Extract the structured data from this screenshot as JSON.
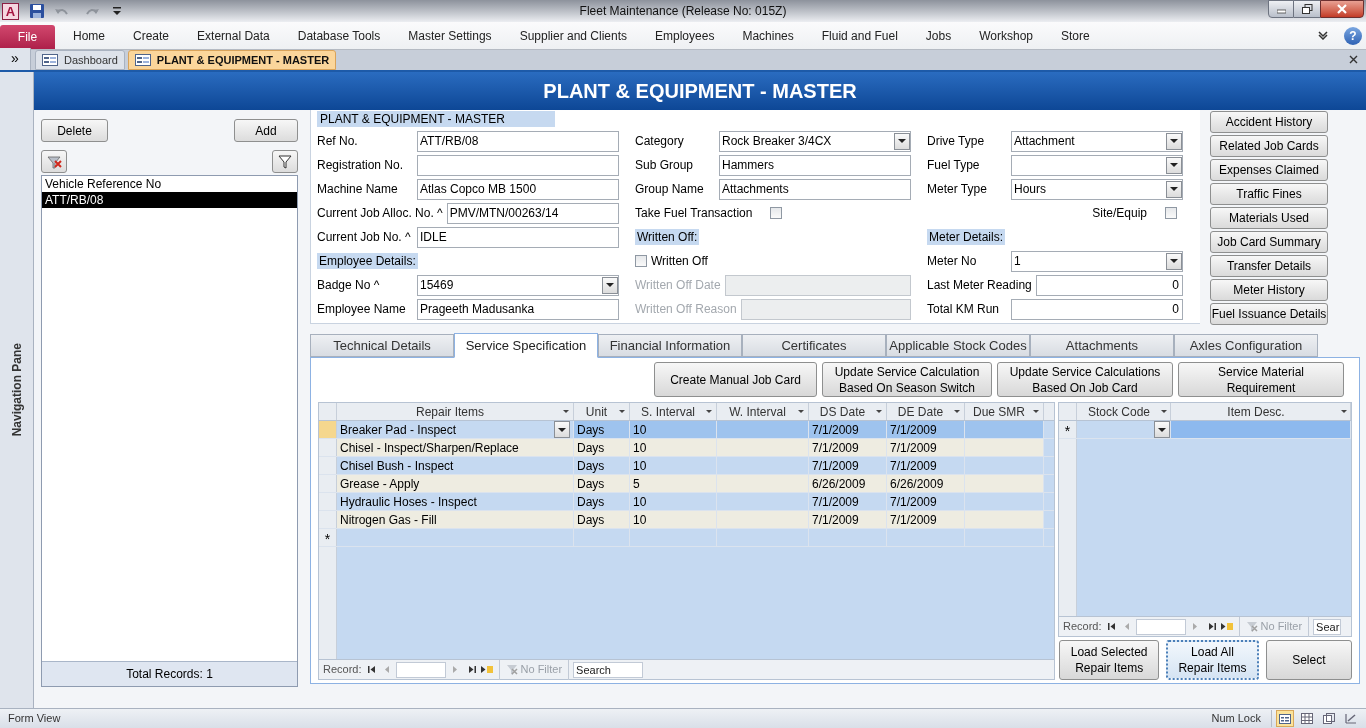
{
  "window": {
    "app_letter": "A",
    "title": "Fleet Maintenance (Release No: 015Z)"
  },
  "ribbon": {
    "file": "File",
    "tabs": [
      "Home",
      "Create",
      "External Data",
      "Database Tools",
      "Master Settings",
      "Supplier and Clients",
      "Employees",
      "Machines",
      "Fluid and Fuel",
      "Jobs",
      "Workshop",
      "Store"
    ],
    "help": "?"
  },
  "nav_pane": {
    "toggle": "»",
    "label": "Navigation Pane"
  },
  "doc_tabs": [
    {
      "label": "Dashboard",
      "selected": false
    },
    {
      "label": "PLANT & EQUIPMENT - MASTER",
      "selected": true
    }
  ],
  "form_title": "PLANT & EQUIPMENT - MASTER",
  "record_list": {
    "buttons": [
      "Delete",
      "Add"
    ],
    "header": "Vehicle Reference No",
    "rows": [
      {
        "label": "ATT/RB/08",
        "selected": true
      }
    ],
    "total": "Total Records: 1"
  },
  "form": {
    "section_title": "PLANT & EQUIPMENT - MASTER",
    "columns": [
      [
        {
          "kind": "text",
          "label": "Ref No.",
          "value": "ATT/RB/08"
        },
        {
          "kind": "text",
          "label": "Registration No."
        },
        {
          "kind": "text",
          "label": "Machine Name",
          "value": "Atlas Copco MB 1500"
        },
        {
          "kind": "text",
          "label": "Current Job Alloc. No. ^",
          "value": "PMV/MTN/00263/14"
        },
        {
          "kind": "text",
          "label": "Current Job No. ^",
          "value": "IDLE"
        },
        {
          "kind": "section",
          "label": "Employee Details:"
        },
        {
          "kind": "combo",
          "label": "Badge No ^",
          "value": "15469"
        },
        {
          "kind": "text",
          "label": "Employee Name",
          "value": "Prageeth Madusanka"
        }
      ],
      [
        {
          "kind": "combo",
          "label": "Category",
          "value": "Rock Breaker 3/4CX"
        },
        {
          "kind": "text",
          "label": "Sub Group",
          "value": "Hammers"
        },
        {
          "kind": "text",
          "label": "Group Name",
          "value": "Attachments"
        },
        {
          "kind": "checkbox",
          "label": "Take Fuel Transaction",
          "checked": false
        },
        {
          "kind": "section",
          "label": "Written Off:"
        },
        {
          "kind": "checkbox_leading",
          "label": "Written Off",
          "checked": false
        },
        {
          "kind": "text",
          "label": "Written Off Date",
          "disabled": true
        },
        {
          "kind": "text",
          "label": "Written Off Reason",
          "disabled": true
        }
      ],
      [
        {
          "kind": "combo",
          "label": "Drive Type",
          "value": "Attachment"
        },
        {
          "kind": "combo",
          "label": "Fuel Type"
        },
        {
          "kind": "combo",
          "label": "Meter Type",
          "value": "Hours"
        },
        {
          "kind": "checkbox",
          "label": "Site/Equip",
          "checked": false
        },
        {
          "kind": "section",
          "label": "Meter Details:"
        },
        {
          "kind": "combo",
          "label": "Meter No",
          "value": "1"
        },
        {
          "kind": "number",
          "label": "Last Meter Reading",
          "value": "0"
        },
        {
          "kind": "number",
          "label": "Total KM Run",
          "value": "0"
        }
      ]
    ]
  },
  "side_buttons": [
    "Accident History",
    "Related Job Cards",
    "Expenses Claimed",
    "Traffic Fines",
    "Materials Used",
    "Job Card Summary",
    "Transfer Details",
    "Meter History",
    "Fuel Issuance Details"
  ],
  "tabs": [
    {
      "label": "Technical Details",
      "selected": false
    },
    {
      "label": "Service Specification",
      "selected": true
    },
    {
      "label": "Financial Information",
      "selected": false
    },
    {
      "label": "Certificates",
      "selected": false
    },
    {
      "label": "Applicable Stock Codes",
      "selected": false
    },
    {
      "label": "Attachments",
      "selected": false
    },
    {
      "label": "Axles Configuration",
      "selected": false
    }
  ],
  "service": {
    "actions": [
      "Create Manual Job Card",
      "Update Service Calculation\nBased On Season Switch",
      "Update Service Calculations\nBased On Job Card",
      "Service Material\nRequirement"
    ],
    "repair_grid": {
      "columns": [
        "Repair Items",
        "Unit",
        "S. Interval",
        "W. Interval",
        "DS Date",
        "DE Date",
        "Due SMR"
      ],
      "rows": [
        {
          "cells": [
            "Breaker Pad - Inspect",
            "Days",
            "10",
            "",
            "7/1/2009",
            "7/1/2009",
            ""
          ],
          "selected": true
        },
        {
          "cells": [
            "Chisel - Inspect/Sharpen/Replace",
            "Days",
            "10",
            "",
            "7/1/2009",
            "7/1/2009",
            ""
          ],
          "selected": false
        },
        {
          "cells": [
            "Chisel Bush - Inspect",
            "Days",
            "10",
            "",
            "7/1/2009",
            "7/1/2009",
            ""
          ],
          "selected": false
        },
        {
          "cells": [
            "Grease - Apply",
            "Days",
            "5",
            "",
            "6/26/2009",
            "6/26/2009",
            ""
          ],
          "selected": false
        },
        {
          "cells": [
            "Hydraulic Hoses - Inspect",
            "Days",
            "10",
            "",
            "7/1/2009",
            "7/1/2009",
            ""
          ],
          "selected": false
        },
        {
          "cells": [
            "Nitrogen Gas - Fill",
            "Days",
            "10",
            "",
            "7/1/2009",
            "7/1/2009",
            ""
          ],
          "selected": false
        }
      ],
      "new_row": {
        "marker": "*",
        "selected": false
      },
      "nav": {
        "record": "Record:",
        "filter": "No Filter",
        "search": "Search"
      }
    },
    "stock_grid": {
      "columns": [
        "Stock Code",
        "Item Desc."
      ],
      "new_row": {
        "marker": "*",
        "selected": true
      },
      "nav": {
        "record": "Record:",
        "filter": "No Filter",
        "search": "Sear"
      }
    },
    "buttons": [
      {
        "label": "Load Selected\nRepair Items",
        "focused": false
      },
      {
        "label": "Load All\nRepair Items",
        "focused": true
      },
      {
        "label": "Select",
        "focused": false
      }
    ]
  },
  "status_bar": {
    "left": "Form View",
    "right": "Num Lock"
  }
}
